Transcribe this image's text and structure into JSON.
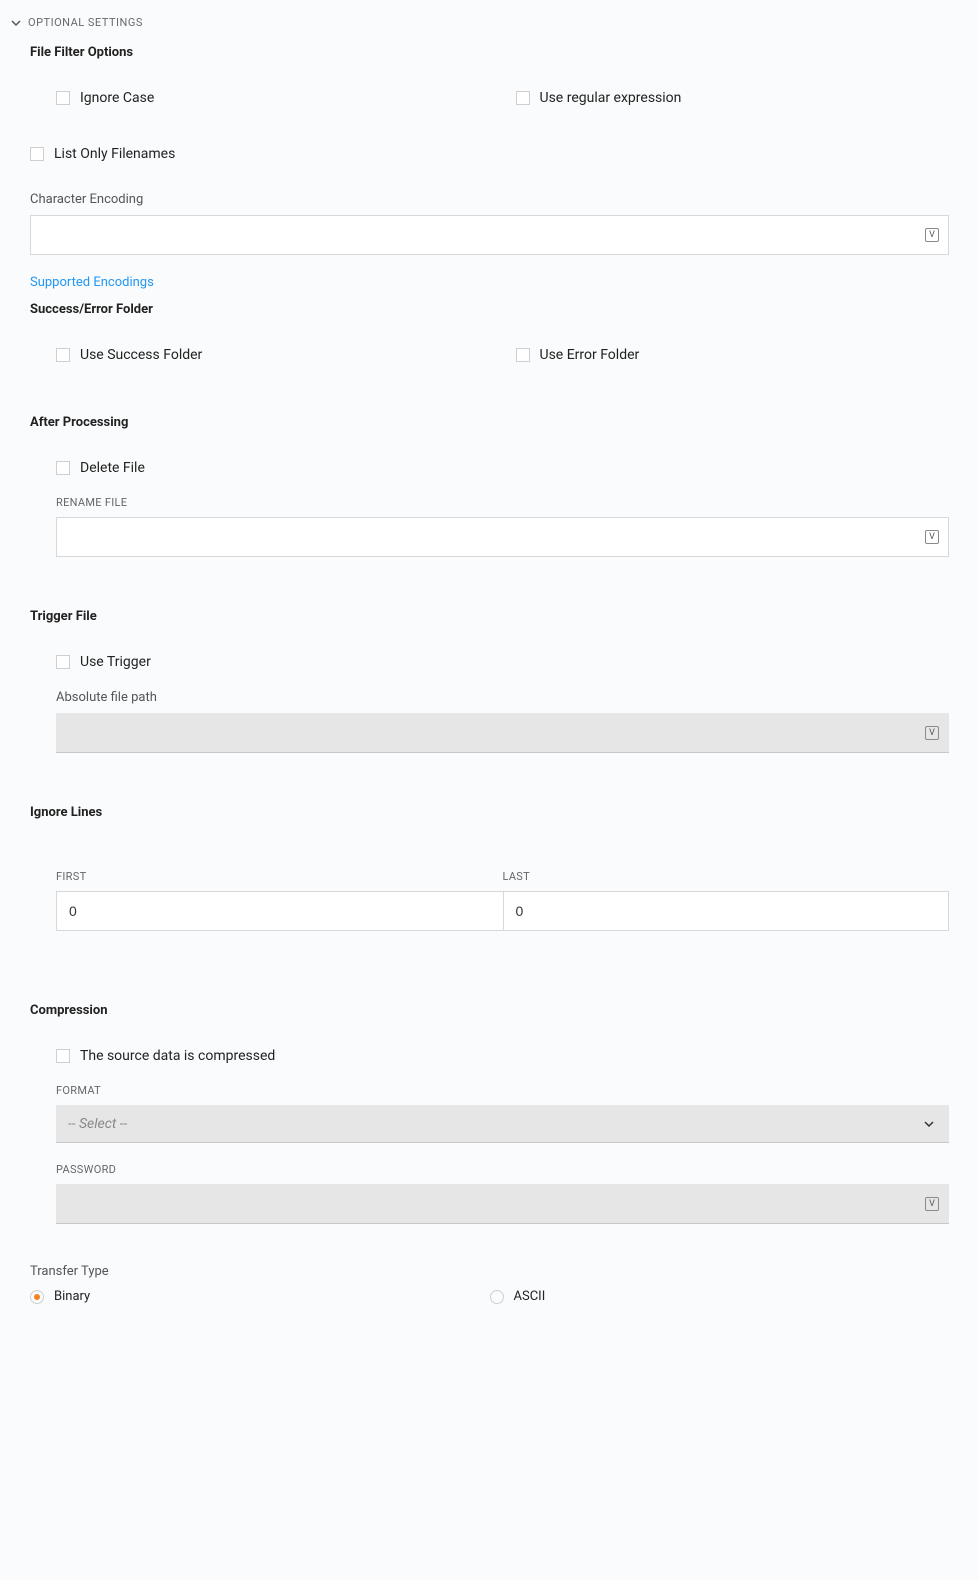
{
  "header": {
    "title": "OPTIONAL SETTINGS"
  },
  "file_filter": {
    "title": "File Filter Options",
    "ignore_case": "Ignore Case",
    "use_regex": "Use regular expression",
    "list_only": "List Only Filenames",
    "encoding_label": "Character Encoding",
    "encoding_value": "",
    "supported_link": "Supported Encodings"
  },
  "folders": {
    "title": "Success/Error Folder",
    "use_success": "Use Success Folder",
    "use_error": "Use Error Folder"
  },
  "after": {
    "title": "After Processing",
    "delete_file": "Delete File",
    "rename_label": "RENAME FILE",
    "rename_value": ""
  },
  "trigger": {
    "title": "Trigger File",
    "use_trigger": "Use Trigger",
    "path_label": "Absolute file path",
    "path_value": ""
  },
  "ignore": {
    "title": "Ignore Lines",
    "first_label": "FIRST",
    "first_value": "0",
    "last_label": "LAST",
    "last_value": "0"
  },
  "compression": {
    "title": "Compression",
    "source_compressed": "The source data is compressed",
    "format_label": "FORMAT",
    "format_placeholder": "-- Select --",
    "password_label": "PASSWORD",
    "password_value": ""
  },
  "transfer": {
    "label": "Transfer Type",
    "binary": "Binary",
    "ascii": "ASCII"
  },
  "icons": {
    "v": "V"
  }
}
